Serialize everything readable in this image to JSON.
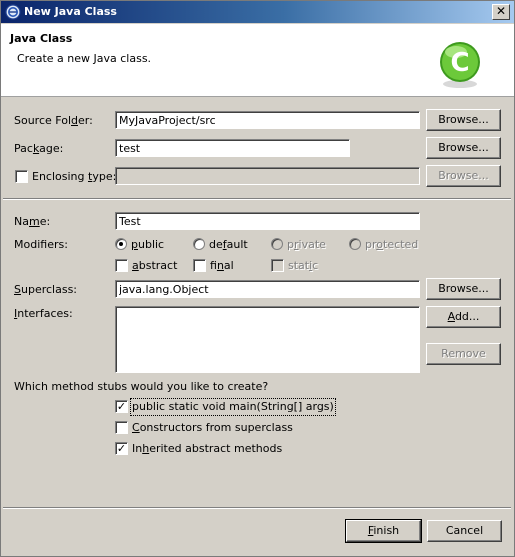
{
  "window": {
    "title": "New Java Class",
    "close_glyph": "✕"
  },
  "banner": {
    "title": "Java Class",
    "description": "Create a new Java class."
  },
  "form": {
    "source_folder": {
      "label": "Source Folder:",
      "value": "MyJavaProject/src",
      "browse": "Browse..."
    },
    "package": {
      "label": "Package:",
      "value": "test",
      "browse": "Browse..."
    },
    "enclosing_type": {
      "label": "Enclosing type:",
      "checked": false,
      "value": "",
      "browse": "Browse..."
    },
    "name": {
      "label": "Name:",
      "value": "Test"
    },
    "modifiers": {
      "label": "Modifiers:",
      "radios": [
        {
          "label": "public",
          "selected": true,
          "enabled": true
        },
        {
          "label": "default",
          "selected": false,
          "enabled": true
        },
        {
          "label": "private",
          "selected": false,
          "enabled": false
        },
        {
          "label": "protected",
          "selected": false,
          "enabled": false
        }
      ],
      "checks": [
        {
          "label": "abstract",
          "checked": false,
          "enabled": true
        },
        {
          "label": "final",
          "checked": false,
          "enabled": true
        },
        {
          "label": "static",
          "checked": false,
          "enabled": false
        }
      ]
    },
    "superclass": {
      "label": "Superclass:",
      "value": "java.lang.Object",
      "browse": "Browse..."
    },
    "interfaces": {
      "label": "Interfaces:",
      "add": "Add...",
      "remove": "Remove"
    },
    "stubs": {
      "question": "Which method stubs would you like to create?",
      "options": [
        {
          "label": "public static void main(String[] args)",
          "checked": true
        },
        {
          "label": "Constructors from superclass",
          "checked": false
        },
        {
          "label": "Inherited abstract methods",
          "checked": true
        }
      ]
    }
  },
  "footer": {
    "finish": "Finish",
    "cancel": "Cancel"
  },
  "colors": {
    "title_bar_start": "#0a246a",
    "title_bar_end": "#a6caf0",
    "dialog_face": "#d4d0c8",
    "logo_green": "#4caf20"
  }
}
